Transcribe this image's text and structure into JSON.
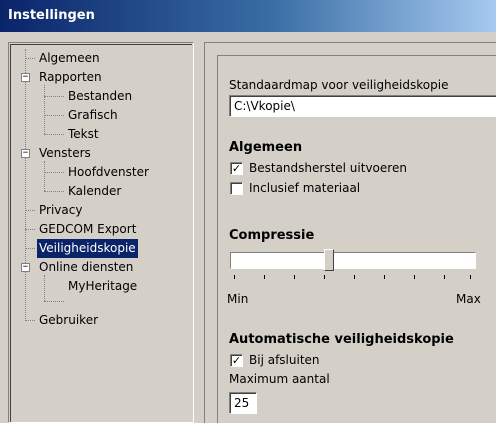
{
  "window": {
    "title": "Instellingen"
  },
  "tree": {
    "items": [
      {
        "label": "Algemeen"
      },
      {
        "label": "Rapporten",
        "expander": "−"
      },
      {
        "label": "Bestanden"
      },
      {
        "label": "Grafisch"
      },
      {
        "label": "Tekst"
      },
      {
        "label": "Vensters",
        "expander": "−"
      },
      {
        "label": "Hoofdvenster"
      },
      {
        "label": "Kalender"
      },
      {
        "label": "Privacy"
      },
      {
        "label": "GEDCOM Export"
      },
      {
        "label": "Veiligheidskopie",
        "selected": true
      },
      {
        "label": "Online diensten",
        "expander": "−"
      },
      {
        "label": "MyHeritage"
      },
      {
        "label": "Gebruiker"
      }
    ]
  },
  "backup": {
    "folder_label": "Standaardmap voor veiligheidskopie",
    "folder_value": "C:\\Vkopie\\",
    "general_heading": "Algemeen",
    "restore_label": "Bestandsherstel uitvoeren",
    "restore_checked": "✓",
    "material_label": "Inclusief materiaal",
    "material_checked": "",
    "compression_heading": "Compressie",
    "compression_min": "Min",
    "compression_max": "Max",
    "compression_level": 0.4,
    "auto_heading": "Automatische veiligheidskopie",
    "on_close_label": "Bij afsluiten",
    "on_close_checked": "✓",
    "max_count_label": "Maximum aantal",
    "max_count_value": "25"
  }
}
